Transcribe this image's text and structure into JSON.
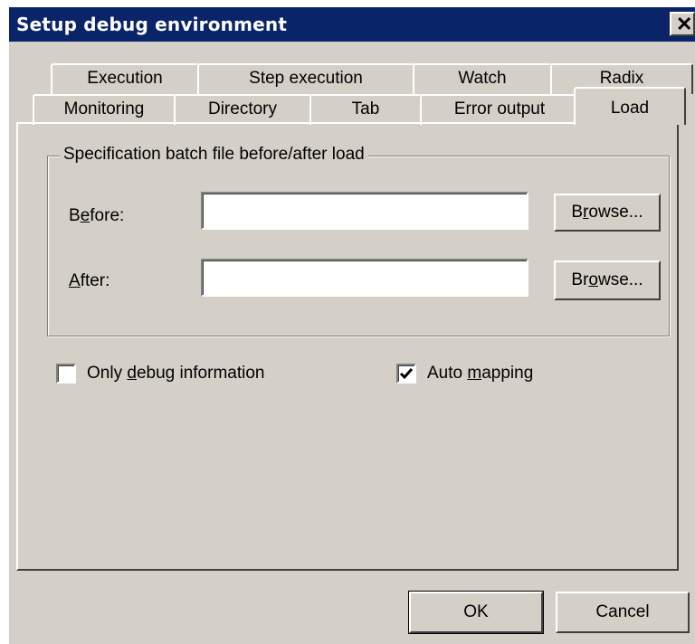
{
  "window": {
    "title": "Setup debug environment",
    "close_glyph": "✕",
    "close_icon": "close-icon"
  },
  "tabs": {
    "row1": [
      {
        "label": "Execution"
      },
      {
        "label": "Step execution"
      },
      {
        "label": "Watch"
      },
      {
        "label": "Radix"
      }
    ],
    "row2": [
      {
        "label": "Monitoring"
      },
      {
        "label": "Directory"
      },
      {
        "label": "Tab"
      },
      {
        "label": "Error output"
      },
      {
        "label": "Load",
        "selected": true
      }
    ]
  },
  "load_page": {
    "group_title": "Specification batch file before/after load",
    "before": {
      "label_pre": "B",
      "label_mnemonic": "e",
      "label_post": "fore:",
      "value": ""
    },
    "after": {
      "label_pre": "",
      "label_mnemonic": "A",
      "label_post": "fter:",
      "value": ""
    },
    "browse_before": {
      "pre": "B",
      "mnemonic": "r",
      "post": "owse..."
    },
    "browse_after": {
      "pre": "Br",
      "mnemonic": "o",
      "post": "wse..."
    },
    "only_debug": {
      "pre": "Only ",
      "mnemonic": "d",
      "post": "ebug information",
      "checked": false
    },
    "auto_mapping": {
      "pre": "Auto ",
      "mnemonic": "m",
      "post": "apping",
      "checked": true
    }
  },
  "buttons": {
    "ok": "OK",
    "cancel": "Cancel"
  },
  "colors": {
    "titlebar": "#0a246a",
    "face": "#d4d0c8"
  }
}
